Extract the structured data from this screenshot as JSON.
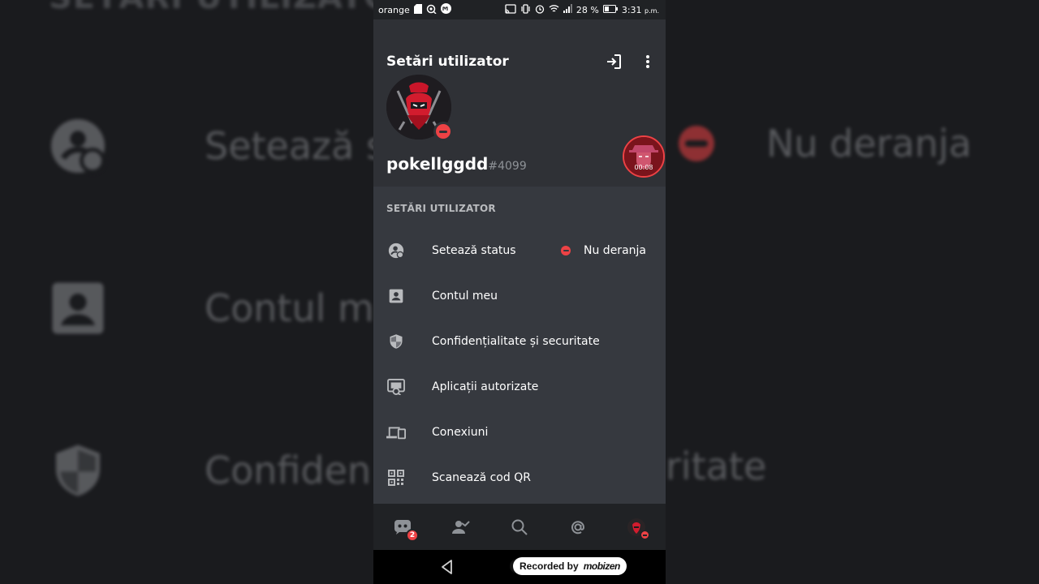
{
  "background": {
    "top_text": "SETĂRI UTILIZATOR",
    "rows": [
      {
        "label": "Setează s",
        "icon": "user-status-icon"
      },
      {
        "label": "Contul m",
        "icon": "account-icon"
      },
      {
        "label": "Confiden",
        "icon": "shield-icon"
      }
    ],
    "right_status": "Nu deranja",
    "right_text": "ritate"
  },
  "statusbar": {
    "carrier": "orange",
    "battery_percent": "28 %",
    "time": "3:31",
    "time_suffix": "p.m."
  },
  "header": {
    "title": "Setări utilizator",
    "logout_icon": "logout-icon",
    "more_icon": "more-vertical-icon"
  },
  "profile": {
    "username": "pokellggdd",
    "discriminator": "#4099",
    "status": "dnd"
  },
  "recording_bubble": {
    "time": "00:08"
  },
  "section": {
    "label": "SETĂRI UTILIZATOR"
  },
  "menu": {
    "items": [
      {
        "label": "Setează status",
        "icon": "user-status-icon",
        "status_text": "Nu deranja"
      },
      {
        "label": "Contul meu",
        "icon": "account-icon"
      },
      {
        "label": "Confidențialitate și securitate",
        "icon": "shield-icon"
      },
      {
        "label": "Aplicații autorizate",
        "icon": "authorized-apps-icon"
      },
      {
        "label": "Conexiuni",
        "icon": "devices-icon"
      },
      {
        "label": "Scanează cod QR",
        "icon": "qr-code-icon"
      }
    ]
  },
  "tabbar": {
    "home_badge": "2",
    "tabs": [
      "home-icon",
      "friends-icon",
      "search-icon",
      "mentions-icon",
      "profile-avatar-icon"
    ]
  },
  "navbar": {
    "recorded_label": "Recorded by",
    "recorder_brand": "mobizen"
  },
  "colors": {
    "background": "#36393f",
    "header": "#2f3136",
    "tabbar": "#202225",
    "dnd": "#ed4245",
    "text": "#ffffff",
    "muted": "#b9bbbe"
  }
}
